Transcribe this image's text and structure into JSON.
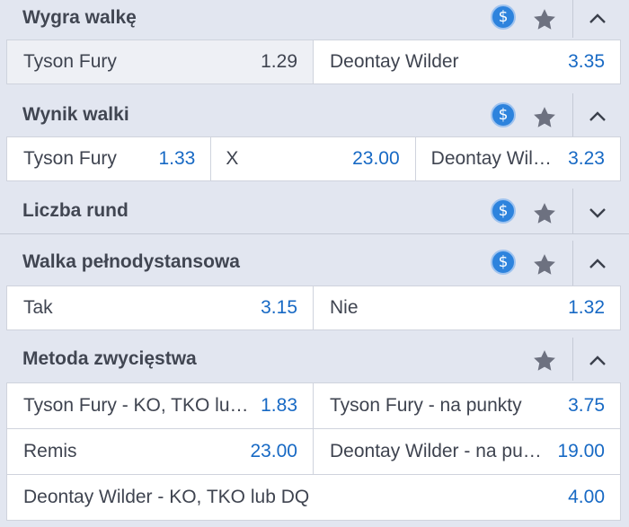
{
  "colors": {
    "odds": "#1769c4",
    "accent_icon": "#2d83dd",
    "background": "#e2e6f0"
  },
  "icons": {
    "cashout": "dollar-icon",
    "favorite": "star-icon",
    "collapse": "chevron-up-icon",
    "expand": "chevron-down-icon"
  },
  "markets": [
    {
      "title": "Wygra walkę",
      "expanded": true,
      "has_cashout": true,
      "rows": [
        [
          {
            "label": "Tyson Fury",
            "odds": "1.29",
            "selected": true
          },
          {
            "label": "Deontay Wilder",
            "odds": "3.35"
          }
        ]
      ]
    },
    {
      "title": "Wynik walki",
      "expanded": true,
      "has_cashout": true,
      "rows": [
        [
          {
            "label": "Tyson Fury",
            "odds": "1.33"
          },
          {
            "label": "X",
            "odds": "23.00"
          },
          {
            "label": "Deontay Wilder",
            "label_display": "Deontay Wil…",
            "odds": "3.23"
          }
        ]
      ]
    },
    {
      "title": "Liczba rund",
      "expanded": false,
      "has_cashout": true,
      "rows": []
    },
    {
      "title": "Walka pełnodystansowa",
      "expanded": true,
      "has_cashout": true,
      "rows": [
        [
          {
            "label": "Tak",
            "odds": "3.15"
          },
          {
            "label": "Nie",
            "odds": "1.32"
          }
        ]
      ]
    },
    {
      "title": "Metoda zwycięstwa",
      "expanded": true,
      "has_cashout": false,
      "rows": [
        [
          {
            "label": "Tyson Fury - KO, TKO lub DQ",
            "label_display": "Tyson Fury - KO, TKO lub…",
            "odds": "1.83"
          },
          {
            "label": "Tyson Fury - na punkty",
            "odds": "3.75"
          }
        ],
        [
          {
            "label": "Remis",
            "odds": "23.00"
          },
          {
            "label": "Deontay Wilder - na punkty",
            "label_display": "Deontay Wilder - na pu…",
            "odds": "19.00"
          }
        ],
        [
          {
            "label": "Deontay Wilder - KO, TKO lub DQ",
            "odds": "4.00"
          }
        ]
      ]
    }
  ]
}
